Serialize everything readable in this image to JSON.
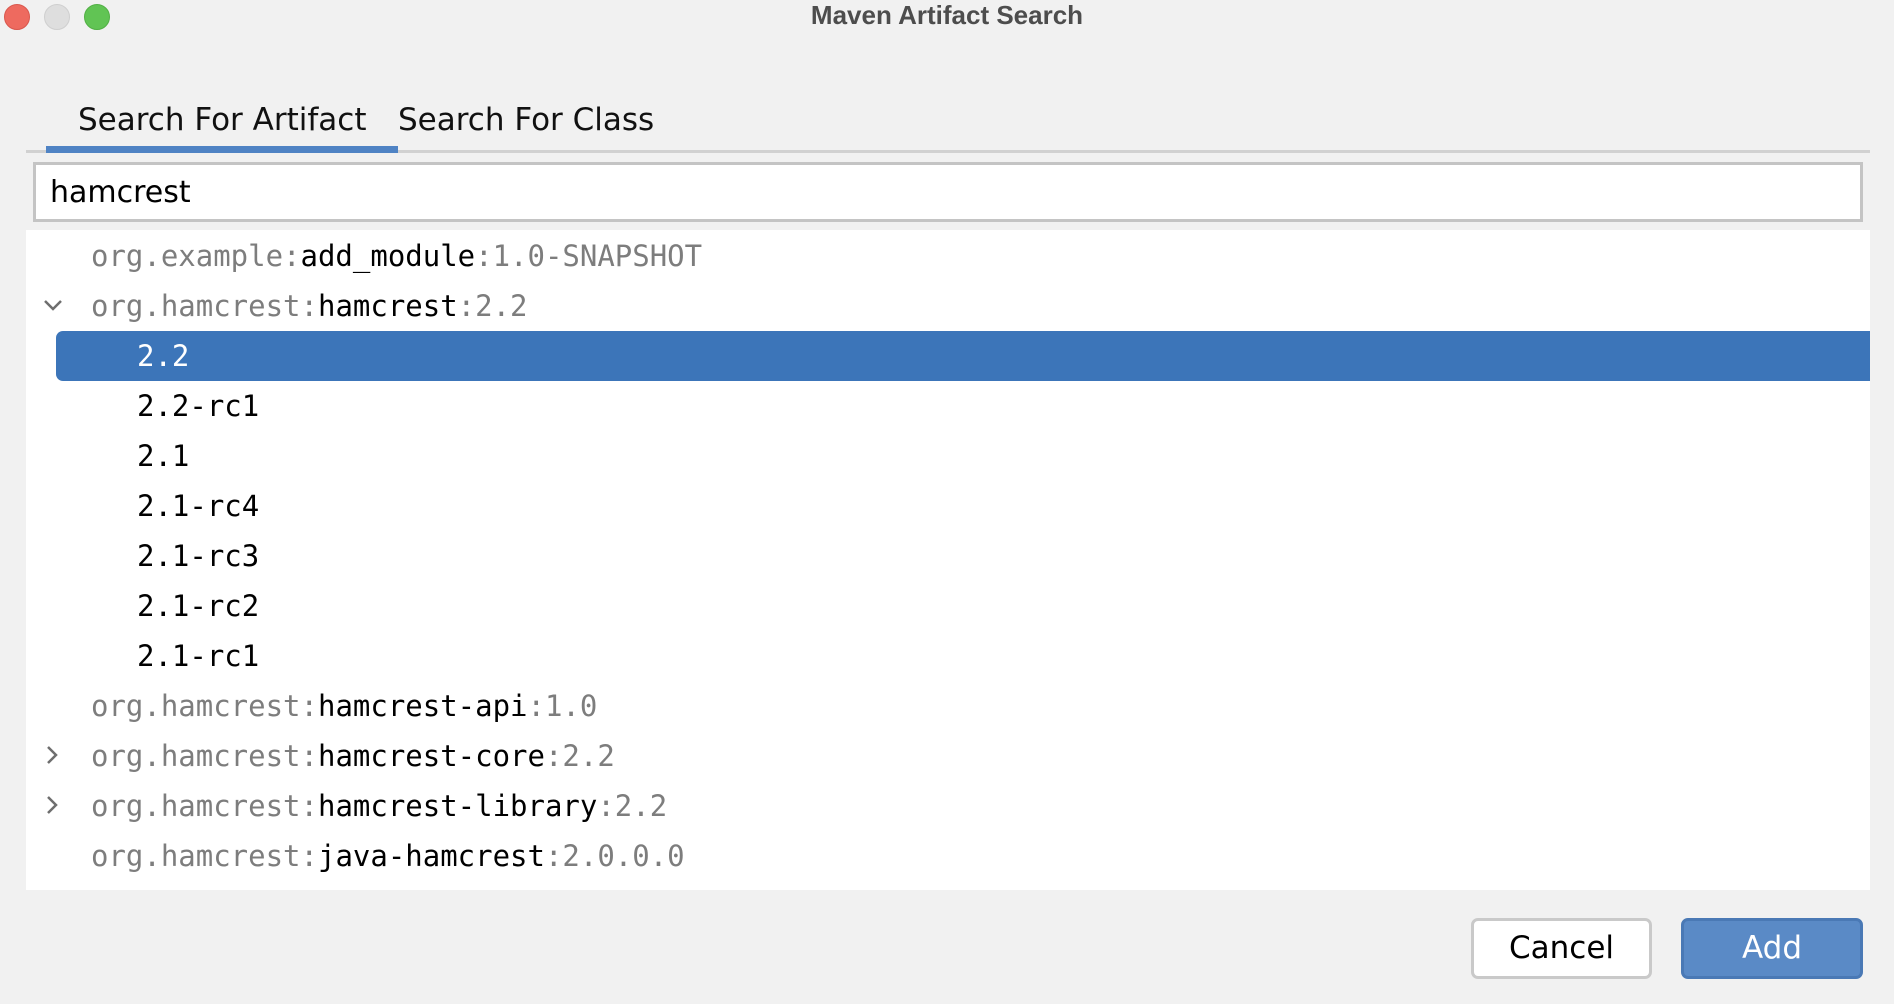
{
  "window": {
    "title": "Maven Artifact Search",
    "controls": [
      "close",
      "minimize",
      "maximize"
    ]
  },
  "tabs": [
    {
      "label": "Search For Artifact",
      "active": true
    },
    {
      "label": "Search For Class",
      "active": false
    }
  ],
  "search": {
    "value": "hamcrest",
    "placeholder": ""
  },
  "results": [
    {
      "level": 1,
      "expander": "none",
      "group": "org.example:",
      "artifact": "add_module",
      "version": ":1.0-SNAPSHOT"
    },
    {
      "level": 1,
      "expander": "expanded",
      "group": "org.hamcrest:",
      "artifact": "hamcrest",
      "version": ":2.2"
    },
    {
      "level": 2,
      "label": "2.2",
      "selected": true
    },
    {
      "level": 2,
      "label": "2.2-rc1"
    },
    {
      "level": 2,
      "label": "2.1"
    },
    {
      "level": 2,
      "label": "2.1-rc4"
    },
    {
      "level": 2,
      "label": "2.1-rc3"
    },
    {
      "level": 2,
      "label": "2.1-rc2"
    },
    {
      "level": 2,
      "label": "2.1-rc1"
    },
    {
      "level": 1,
      "expander": "none",
      "group": "org.hamcrest:",
      "artifact": "hamcrest-api",
      "version": ":1.0"
    },
    {
      "level": 1,
      "expander": "collapsed",
      "group": "org.hamcrest:",
      "artifact": "hamcrest-core",
      "version": ":2.2"
    },
    {
      "level": 1,
      "expander": "collapsed",
      "group": "org.hamcrest:",
      "artifact": "hamcrest-library",
      "version": ":2.2"
    },
    {
      "level": 1,
      "expander": "none",
      "group": "org.hamcrest:",
      "artifact": "java-hamcrest",
      "version": ":2.0.0.0"
    }
  ],
  "buttons": {
    "cancel": "Cancel",
    "add": "Add"
  },
  "colors": {
    "accent": "#4f83c4",
    "selection": "#3c75b9",
    "primary_button": "#5a8ac6",
    "dim_text": "#7d7d7d"
  }
}
